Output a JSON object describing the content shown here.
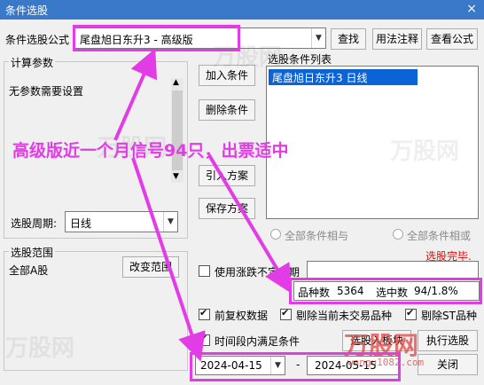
{
  "window": {
    "title": "条件选股",
    "close": "×"
  },
  "formula": {
    "label": "条件选股公式",
    "value": "尾盘旭日东升3  -  高级版",
    "find_button": "查找",
    "usage_button": "用法注释",
    "view_button": "查看公式"
  },
  "calc_params": {
    "legend": "计算参数",
    "text": "无参数需要设置"
  },
  "period": {
    "label": "选股周期:",
    "value": "日线"
  },
  "stock_range": {
    "legend": "选股范围",
    "value": "全部A股",
    "change_button": "改变范围"
  },
  "buttons": {
    "add": "加入条件",
    "remove": "删除条件",
    "import": "引入方案",
    "save": "保存方案"
  },
  "condition_list": {
    "legend": "选股条件列表",
    "items": [
      "尾盘旭日东升3  日线"
    ]
  },
  "radios": {
    "and": "全部条件相与",
    "or": "全部条件相或"
  },
  "status": {
    "done": "选股完毕."
  },
  "rise_period": {
    "label": "使用涨跌不定周期"
  },
  "stats": {
    "count_label": "品种数",
    "count_value": "5364",
    "selected_label": "选中数",
    "selected_value": "94/1.8%"
  },
  "options": {
    "forward_adjust": "前复权数据",
    "exclude_untraded": "剔除当前未交易品种",
    "exclude_st": "剔除ST品种",
    "time_range": "时间段内满足条件"
  },
  "dates": {
    "start": "2024-04-15",
    "separator": "-",
    "end": "2024-05-15"
  },
  "actions": {
    "to_board": "选股入板块",
    "execute": "执行选股",
    "close": "关闭"
  },
  "annotation": {
    "text": "高级版近一个月信号94只，出票适中",
    "color": "#e23ce6"
  },
  "watermark": {
    "text": "万股网",
    "url": "wangu1082.com"
  },
  "colors": {
    "accent": "#e23ce6",
    "selection": "#0b63d6",
    "status_red": "#e01010",
    "title_bar": "#3a78c9"
  }
}
